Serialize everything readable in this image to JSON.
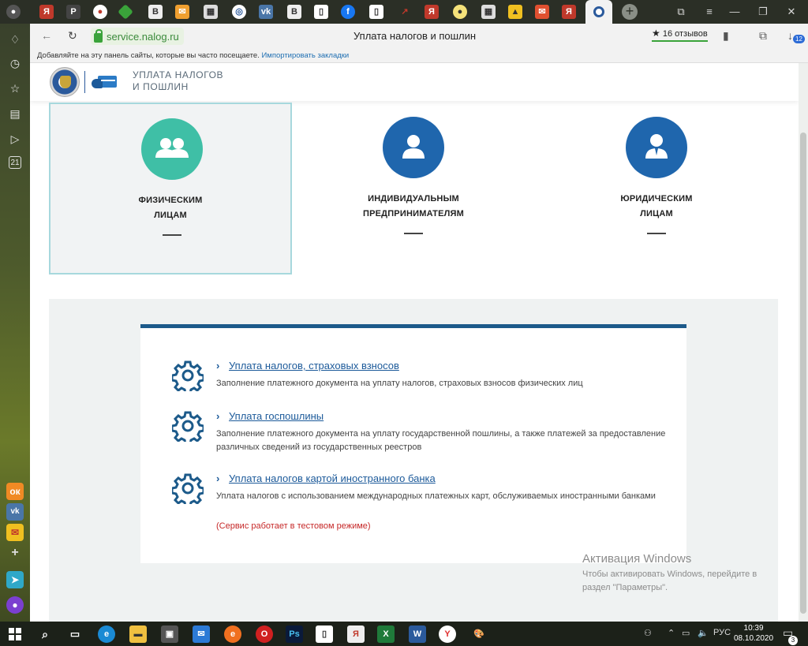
{
  "browser": {
    "domain": "service.nalog.ru",
    "page_title": "Уплата налогов и пошлин",
    "reviews_label": "16 отзывов",
    "downloads_badge": "12",
    "bookmarks_text": "Добавляйте на эту панель сайты, которые вы часто посещаете.",
    "bookmarks_link": "Импортировать закладки",
    "sidebar_badge": "21"
  },
  "site": {
    "title_line1": "УПЛАТА НАЛОГОВ",
    "title_line2": "И ПОШЛИН"
  },
  "categories": [
    {
      "line1": "ФИЗИЧЕСКИМ",
      "line2": "ЛИЦАМ",
      "color": "#3fbfa6"
    },
    {
      "line1": "ИНДИВИДУАЛЬНЫМ",
      "line2": "ПРЕДПРИНИМАТЕЛЯМ",
      "color": "#1f66ad"
    },
    {
      "line1": "ЮРИДИЧЕСКИМ",
      "line2": "ЛИЦАМ",
      "color": "#1f66ad"
    }
  ],
  "services": [
    {
      "title": "Уплата налогов, страховых взносов",
      "desc": "Заполнение платежного документа на уплату налогов, страховых взносов физических лиц"
    },
    {
      "title": "Уплата госпошлины",
      "desc": "Заполнение платежного документа на уплату государственной пошлины, а также платежей за предоставление различных сведений из государственных реестров"
    },
    {
      "title": "Уплата налогов картой иностранного банка",
      "desc": "Уплата налогов с использованием международных платежных карт, обслуживаемых иностранными банками",
      "note": "(Сервис работает в тестовом режиме)"
    }
  ],
  "watermark": {
    "title": "Активация Windows",
    "text": "Чтобы активировать Windows, перейдите в раздел \"Параметры\"."
  },
  "taskbar": {
    "lang": "РУС",
    "time": "10:39",
    "date": "08.10.2020",
    "notifications": "3"
  },
  "colors": {
    "accent": "#1c5a8a",
    "link": "#1c5a9a",
    "note": "#c62828",
    "teal": "#3fbfa6",
    "blue": "#1f66ad"
  }
}
